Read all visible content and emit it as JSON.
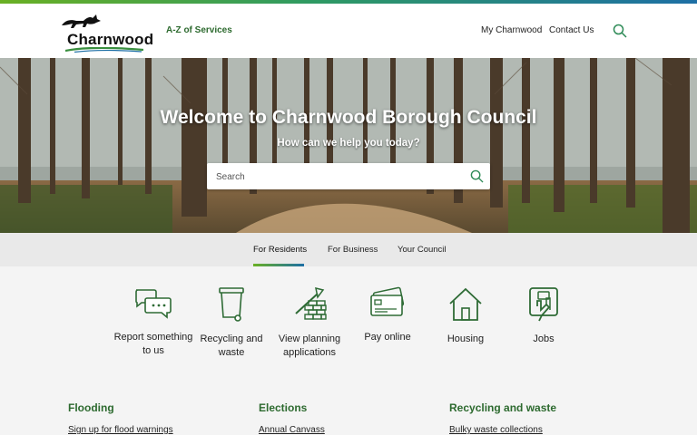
{
  "header": {
    "logo_text": "Charnwood",
    "az_link": "A-Z of Services",
    "nav": [
      "My Charnwood",
      "Contact Us"
    ],
    "search_icon": "search-icon"
  },
  "hero": {
    "title": "Welcome to Charnwood Borough Council",
    "subtitle": "How can we help you today?",
    "search_placeholder": "Search"
  },
  "tabs": {
    "items": [
      "For Residents",
      "For Business",
      "Your Council"
    ],
    "active": "For Residents"
  },
  "services": [
    {
      "label": "Report something to us",
      "icon": "chat-bubbles-icon"
    },
    {
      "label": "Recycling and waste",
      "icon": "wheelie-bin-icon"
    },
    {
      "label": "View planning applications",
      "icon": "trowel-bricks-icon"
    },
    {
      "label": "Pay online",
      "icon": "payment-card-icon"
    },
    {
      "label": "Housing",
      "icon": "house-icon"
    },
    {
      "label": "Jobs",
      "icon": "hand-badge-icon"
    }
  ],
  "columns": [
    {
      "heading": "Flooding",
      "first_link": "Sign up for flood warnings"
    },
    {
      "heading": "Elections",
      "first_link": "Annual Canvass"
    },
    {
      "heading": "Recycling and waste",
      "first_link": "Bulky waste collections"
    }
  ],
  "colors": {
    "brand_green": "#2d6a2f",
    "accent_blue": "#1d6fa5",
    "icon_green": "#2e6b35"
  }
}
